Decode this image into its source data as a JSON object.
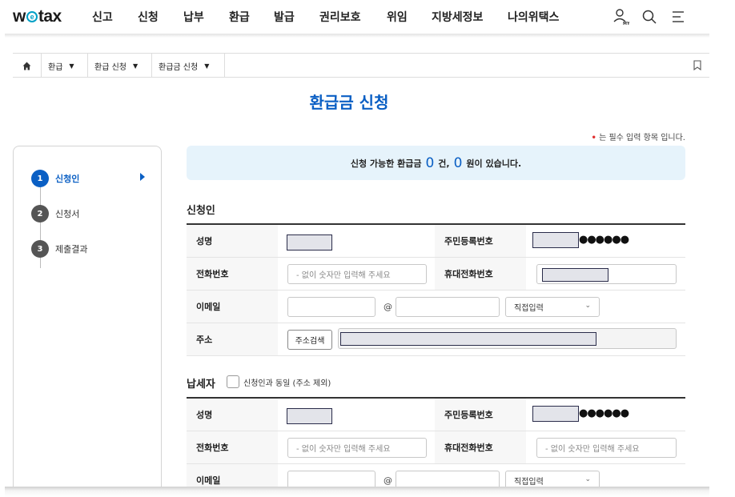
{
  "header": {
    "logo": "w@tax",
    "logo_pre": "w",
    "logo_mid": "e",
    "logo_post": "tax",
    "nav": [
      "신고",
      "신청",
      "납부",
      "환급",
      "발급",
      "권리보호",
      "위임",
      "지방세정보",
      "나의위택스"
    ],
    "my_badge": "MY"
  },
  "breadcrumb": {
    "items": [
      "환급",
      "환급 신청",
      "환급금 신청"
    ]
  },
  "page_title": "환급금 신청",
  "required_note": "는 필수 입력 항목 입니다.",
  "required_mark": "•",
  "steps": [
    {
      "num": "1",
      "label": "신청인",
      "active": true
    },
    {
      "num": "2",
      "label": "신청서",
      "active": false
    },
    {
      "num": "3",
      "label": "제출결과",
      "active": false
    }
  ],
  "banner": {
    "prefix": "신청 가능한 환급금",
    "count": "0",
    "mid": "건,",
    "amount": "0",
    "suffix": "원이 있습니다."
  },
  "applicant": {
    "title": "신청인",
    "name_label": "성명",
    "rrn_label": "주민등록번호",
    "rrn_dots": "●●●●●●",
    "phone_label": "전화번호",
    "phone_placeholder": "- 없이 숫자만 입력해 주세요",
    "mobile_label": "휴대전화번호",
    "email_label": "이메일",
    "email_at": "@",
    "email_select": "직접입력",
    "address_label": "주소",
    "address_button": "주소검색"
  },
  "taxpayer": {
    "title": "납세자",
    "same_checkbox": "신청인과 동일 (주소 제외)",
    "name_label": "성명",
    "rrn_label": "주민등록번호",
    "rrn_dots": "●●●●●●",
    "phone_label": "전화번호",
    "phone_placeholder": "- 없이 숫자만 입력해 주세요",
    "mobile_label": "휴대전화번호",
    "mobile_placeholder": "- 없이 숫자만 입력해 주세요",
    "email_label": "이메일",
    "email_at": "@",
    "email_select": "직접입력"
  },
  "colors": {
    "accent": "#0a5fc4",
    "banner_bg": "#e6f3fb",
    "required": "#e03131",
    "logo_e": "#00a0c6"
  },
  "icons": [
    "home-icon",
    "user-icon",
    "search-icon",
    "menu-icon",
    "bookmark-icon",
    "caret-down-icon",
    "chevron-down-icon",
    "step-arrow-icon"
  ]
}
